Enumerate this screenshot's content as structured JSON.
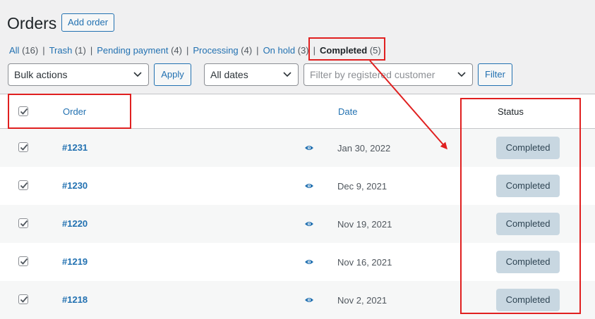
{
  "header": {
    "title": "Orders",
    "add_button": "Add order"
  },
  "filters_nav": [
    {
      "label": "All",
      "count": "(16)"
    },
    {
      "label": "Trash",
      "count": "(1)"
    },
    {
      "label": "Pending payment",
      "count": "(4)"
    },
    {
      "label": "Processing",
      "count": "(4)"
    },
    {
      "label": "On hold",
      "count": "(3)"
    },
    {
      "label": "Completed",
      "count": "(5)",
      "current": true
    }
  ],
  "toolbar": {
    "bulk_actions": "Bulk actions",
    "apply": "Apply",
    "dates": "All dates",
    "customer_placeholder": "Filter by registered customer",
    "filter": "Filter"
  },
  "table": {
    "columns": {
      "order": "Order",
      "date": "Date",
      "status": "Status"
    },
    "rows": [
      {
        "order": "#1231",
        "date": "Jan 30, 2022",
        "status": "Completed"
      },
      {
        "order": "#1230",
        "date": "Dec 9, 2021",
        "status": "Completed"
      },
      {
        "order": "#1220",
        "date": "Nov 19, 2021",
        "status": "Completed"
      },
      {
        "order": "#1219",
        "date": "Nov 16, 2021",
        "status": "Completed"
      },
      {
        "order": "#1218",
        "date": "Nov 2, 2021",
        "status": "Completed"
      }
    ]
  },
  "colors": {
    "link": "#2271b1",
    "annotation": "#e02020",
    "status_badge": "#c8d7e1"
  }
}
